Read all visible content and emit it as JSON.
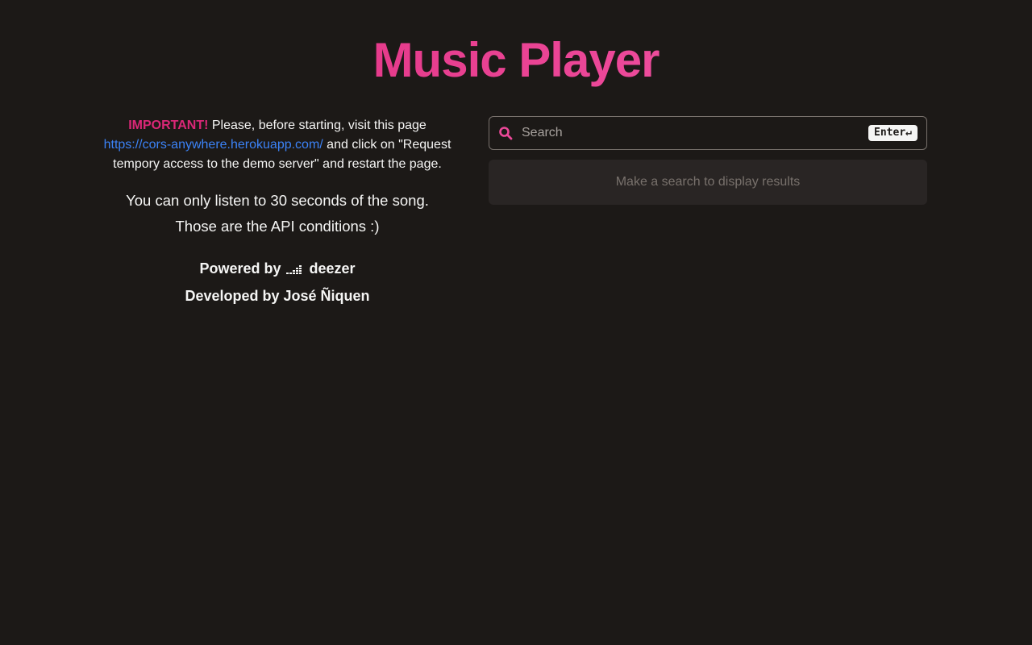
{
  "header": {
    "title": "Music Player"
  },
  "notice": {
    "important_label": "IMPORTANT!",
    "text_before_link": " Please, before starting, visit this page ",
    "link_text": "https://cors-anywhere.herokuapp.com/",
    "text_after_link": " and click on \"Request tempory access to the demo server\" and restart the page."
  },
  "conditions": {
    "line1": "You can only listen to 30 seconds of the song.",
    "line2": "Those are the API conditions :)"
  },
  "credits": {
    "powered_by": "Powered by",
    "brand": "deezer",
    "developed_by": "Developed by José Ñiquen"
  },
  "search": {
    "placeholder": "Search",
    "value": "",
    "enter_key": "Enter↵",
    "icon": "search-icon"
  },
  "results": {
    "empty_message": "Make a search to display results"
  },
  "colors": {
    "background": "#1c1917",
    "accent": "#db2777",
    "link": "#3b82f6",
    "results_bg": "#292524"
  }
}
